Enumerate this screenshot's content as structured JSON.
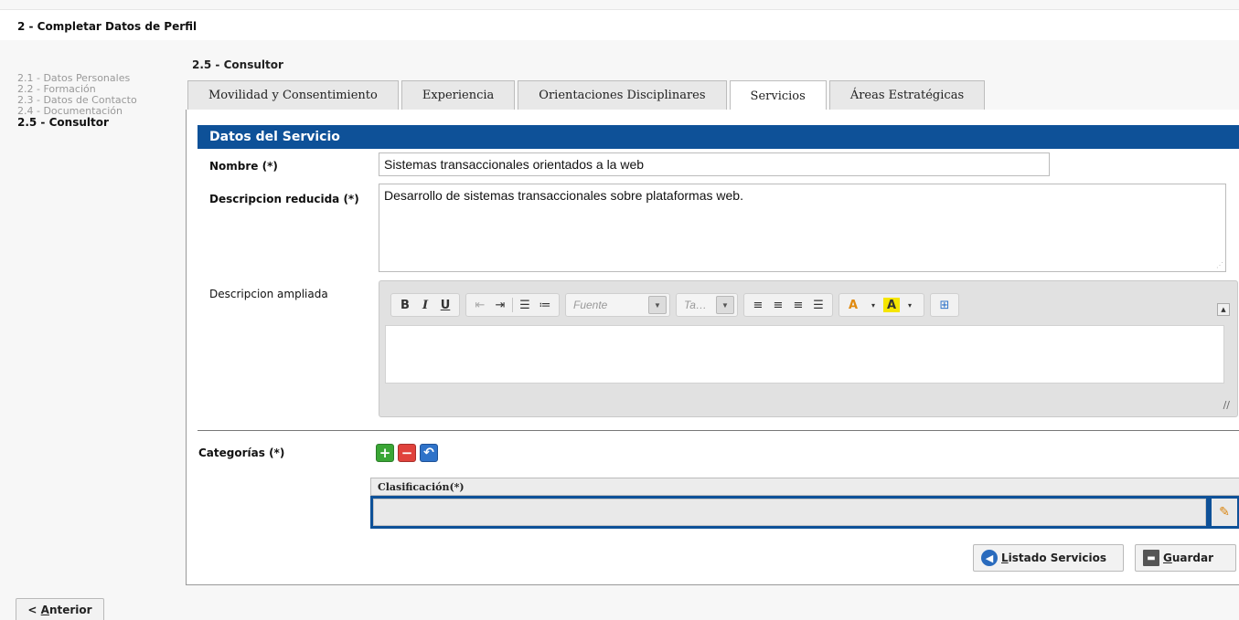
{
  "header": {
    "title": "2 - Completar Datos de Perfil"
  },
  "steps": [
    {
      "label": "2.1 - Datos Personales",
      "active": false
    },
    {
      "label": "2.2 - Formación",
      "active": false
    },
    {
      "label": "2.3 - Datos de Contacto",
      "active": false
    },
    {
      "label": "2.4 - Documentación",
      "active": false
    },
    {
      "label": "2.5 - Consultor",
      "active": true
    }
  ],
  "section": {
    "title": "2.5 - Consultor"
  },
  "tabs": [
    {
      "label": "Movilidad y Consentimiento",
      "active": false
    },
    {
      "label": "Experiencia",
      "active": false
    },
    {
      "label": "Orientaciones Disciplinares",
      "active": false
    },
    {
      "label": "Servicios",
      "active": true
    },
    {
      "label": "Áreas Estratégicas",
      "active": false
    }
  ],
  "form": {
    "header": "Datos del Servicio",
    "nombre_label": "Nombre (*)",
    "nombre_value": "Sistemas transaccionales orientados a la web",
    "desc_reducida_label": "Descripcion reducida (*)",
    "desc_reducida_value": "Desarrollo de sistemas transaccionales sobre plataformas web.",
    "desc_ampliada_label": "Descripcion ampliada",
    "categorias_label": "Categorías (*)"
  },
  "editor": {
    "bold": "B",
    "italic": "I",
    "underline": "U",
    "font_placeholder": "Fuente",
    "size_placeholder": "Ta…"
  },
  "grid": {
    "column_header": "Clasificación(*)"
  },
  "buttons": {
    "listado_key": "L",
    "listado_rest": "istado Servicios",
    "guardar_key": "G",
    "guardar_rest": "uardar",
    "anterior_prefix": "< ",
    "anterior_key": "A",
    "anterior_rest": "nterior"
  },
  "colors": {
    "accent": "#0e5198"
  }
}
